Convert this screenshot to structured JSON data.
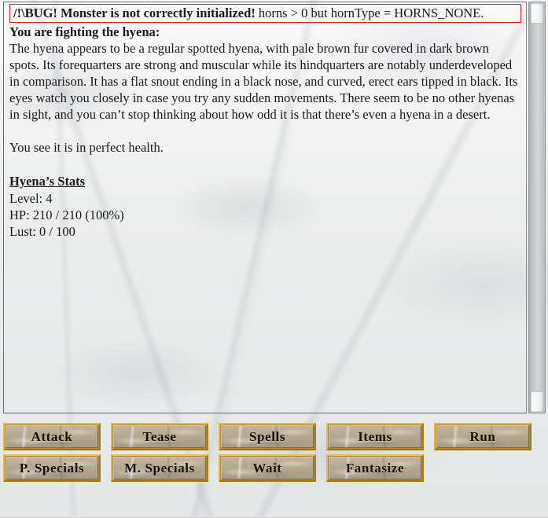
{
  "window": {
    "background": "#eff0f0",
    "accent_gold": "#c79a2c",
    "error_border": "#e02020"
  },
  "combat_log": {
    "bug_banner": {
      "bold_part": "/!\\BUG! Monster is not correctly initialized!",
      "normal_part": " horns > 0 but hornType = HORNS_NONE."
    },
    "heading": "You are fighting the hyena:",
    "description": "The hyena appears to be a regular spotted hyena, with pale brown fur covered in dark brown spots. Its forequarters are strong and muscular while its hindquarters are notably underdeveloped in comparison. It has a flat snout ending in a black nose, and curved, erect ears tipped in black. Its eyes watch you closely in case you try any sudden movements. There seem to be no other hyenas in sight, and you can’t stop thinking about how odd it is that there’s even a hyena in a desert.",
    "health_note": "You see it is in perfect health.",
    "stats_title": "Hyena’s Stats",
    "stats": [
      "Level: 4",
      "HP: 210 / 210 (100%)",
      "Lust: 0 / 100"
    ]
  },
  "scrollbar": {
    "name": "text-scrollbar",
    "position": "right"
  },
  "actions": {
    "row1": [
      {
        "label": "Attack",
        "name": "attack-button"
      },
      {
        "label": "Tease",
        "name": "tease-button"
      },
      {
        "label": "Spells",
        "name": "spells-button"
      },
      {
        "label": "Items",
        "name": "items-button"
      },
      {
        "label": "Run",
        "name": "run-button"
      }
    ],
    "row2": [
      {
        "label": "P. Specials",
        "name": "physical-specials-button"
      },
      {
        "label": "M. Specials",
        "name": "magical-specials-button"
      },
      {
        "label": "Wait",
        "name": "wait-button"
      },
      {
        "label": "Fantasize",
        "name": "fantasize-button"
      }
    ]
  }
}
